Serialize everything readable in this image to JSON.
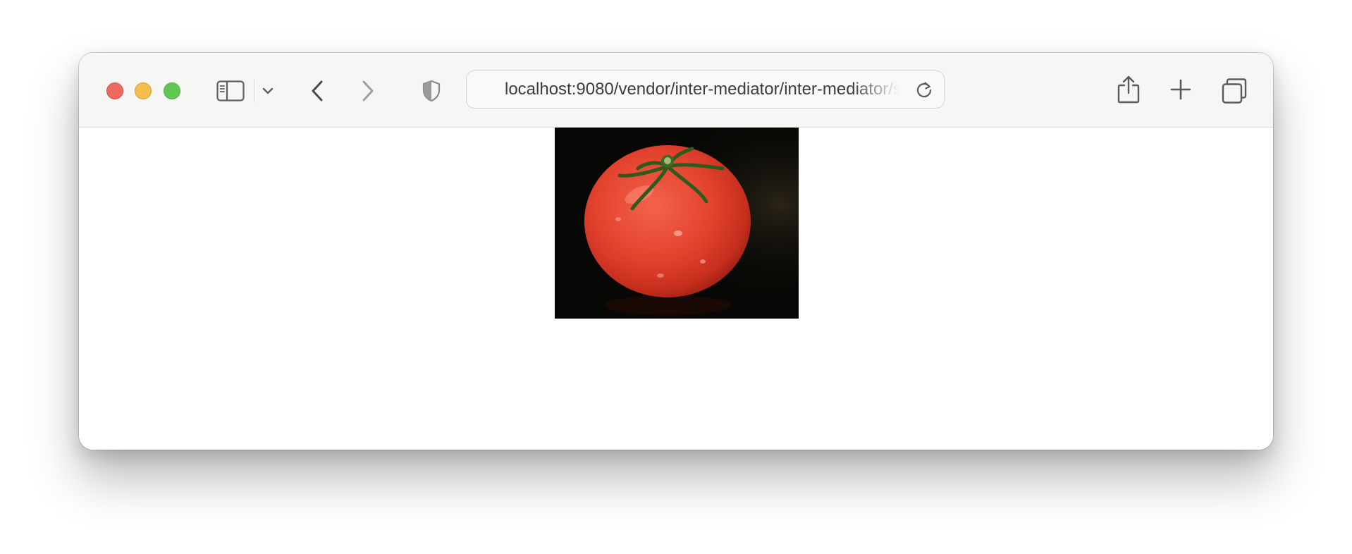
{
  "browser": {
    "address_bar": {
      "url": "localhost:9080/vendor/inter-mediator/inter-mediator/samples/"
    },
    "icons": {
      "close": "close-traffic-light",
      "minimize": "minimize-traffic-light",
      "maximize": "maximize-traffic-light",
      "sidebar": "sidebar-icon",
      "tab_group_menu": "chevron-down-icon",
      "back": "chevron-left-icon",
      "forward": "chevron-right-icon",
      "privacy": "shield-icon",
      "reload": "reload-icon",
      "share": "share-icon",
      "new_tab": "plus-icon",
      "tab_overview": "tabs-overview-icon"
    },
    "colors": {
      "close": "#ee6a5f",
      "minimize": "#f5be4f",
      "maximize": "#62c655"
    }
  },
  "page": {
    "image": {
      "subject": "tomato"
    }
  }
}
